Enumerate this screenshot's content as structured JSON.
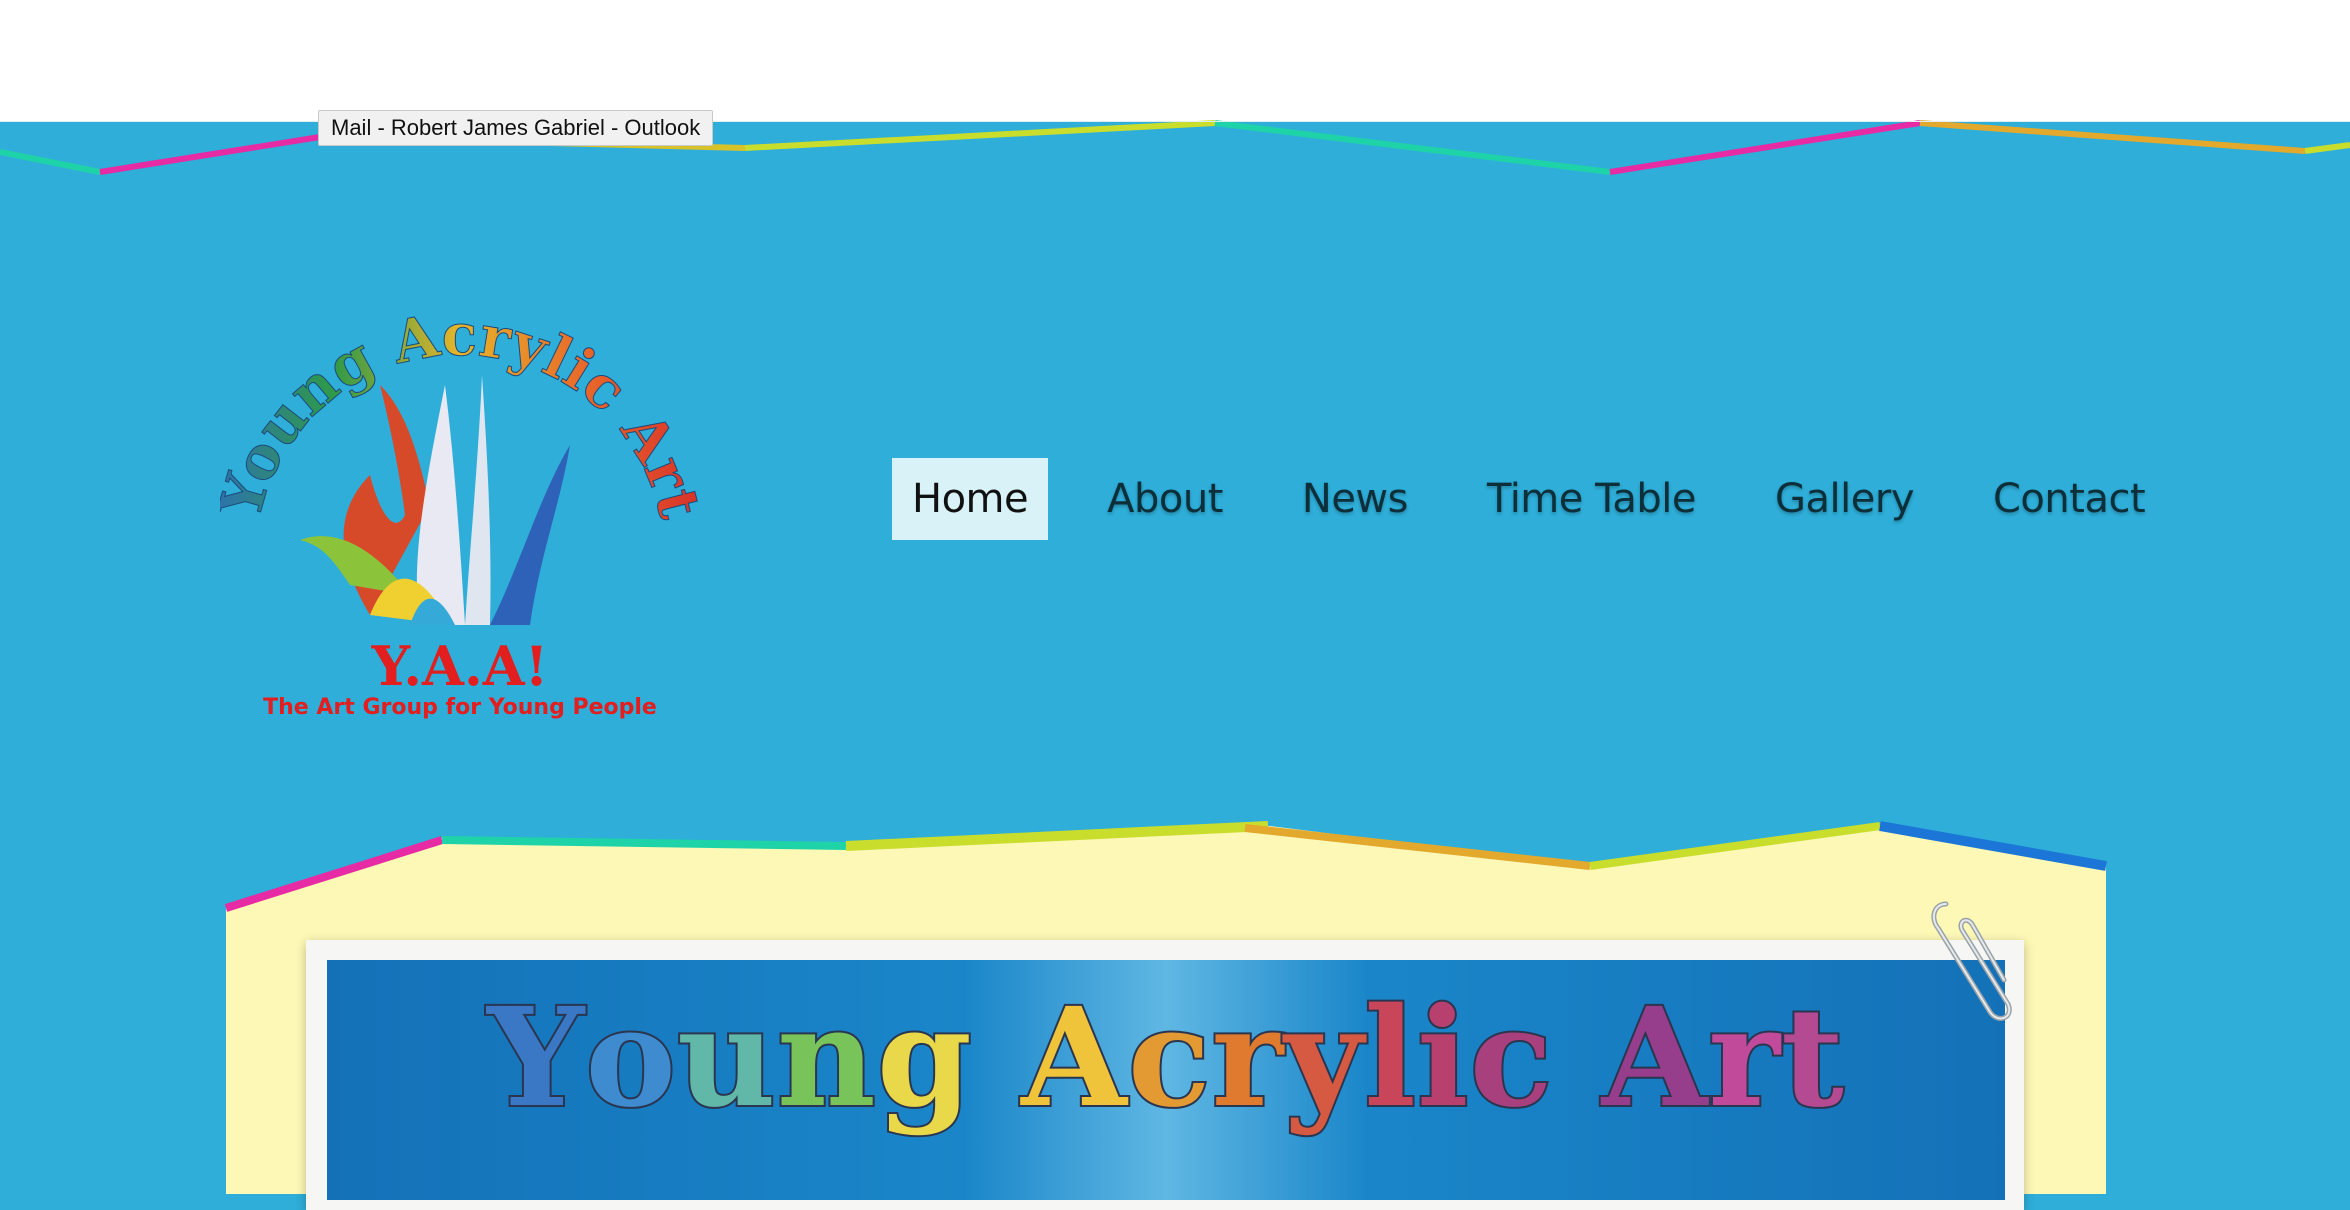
{
  "tooltip": {
    "text": "Mail - Robert James Gabriel - Outlook"
  },
  "logo": {
    "arc_text": "Young Acrylic Art",
    "acronym": "Y.A.A!",
    "tagline": "The Art Group for Young People"
  },
  "nav": {
    "items": [
      {
        "label": "Home",
        "active": true
      },
      {
        "label": "About"
      },
      {
        "label": "News"
      },
      {
        "label": "Time Table"
      },
      {
        "label": "Gallery"
      },
      {
        "label": "Contact"
      }
    ]
  },
  "banner": {
    "title": "Young Acrylic Art",
    "letter_colors": [
      "#3a78c6",
      "#3f8bd0",
      "#62b8a8",
      "#78c45a",
      "#e9d84a",
      "#f0c43a",
      "#e39a33",
      "#e07a2e",
      "#d65a42",
      "#c9455a",
      "#b8406e",
      "#a8407e",
      "#963e8c",
      "#c24a9a",
      "#b34a92",
      "#9c4388",
      "#8a3f7e"
    ]
  },
  "colors": {
    "page_bg": "#2eaed9",
    "content_bg": "#fdf8b6",
    "nav_active_bg": "#d9f2f8"
  },
  "icons": {
    "paperclip": "paperclip-icon"
  }
}
